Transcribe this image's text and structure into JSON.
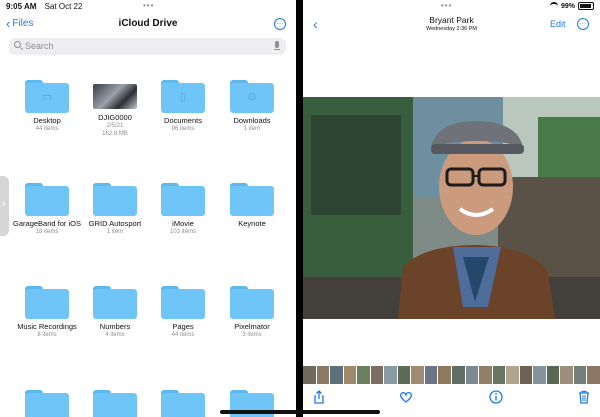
{
  "status": {
    "time": "9:05 AM",
    "date": "Sat Oct 22",
    "wifi_icon": "wifi-icon",
    "battery": "99%",
    "battery_icon": "battery-icon"
  },
  "files": {
    "back_label": "Files",
    "title": "iCloud Drive",
    "more_icon": "ellipsis-circle-icon",
    "search_placeholder": "Search",
    "items": [
      {
        "name": "Desktop",
        "meta": "44 items",
        "meta2": "",
        "kind": "folder",
        "glyph": "▭"
      },
      {
        "name": "DJIG0000",
        "meta": "2/5/21",
        "meta2": "162.8 MB",
        "kind": "image",
        "glyph": ""
      },
      {
        "name": "Documents",
        "meta": "86 items",
        "meta2": "",
        "kind": "folder",
        "glyph": "▯"
      },
      {
        "name": "Downloads",
        "meta": "1 item",
        "meta2": "",
        "kind": "folder",
        "glyph": "⊙"
      },
      {
        "name": "GarageBand for iOS",
        "meta": "18 items",
        "meta2": "",
        "kind": "folder",
        "glyph": ""
      },
      {
        "name": "GRID Autosport",
        "meta": "1 item",
        "meta2": "",
        "kind": "folder",
        "glyph": ""
      },
      {
        "name": "iMovie",
        "meta": "103 items",
        "meta2": "",
        "kind": "folder",
        "glyph": ""
      },
      {
        "name": "Keynote",
        "meta": "",
        "meta2": "",
        "kind": "folder",
        "glyph": ""
      },
      {
        "name": "Music Recordings",
        "meta": "8 items",
        "meta2": "",
        "kind": "folder",
        "glyph": ""
      },
      {
        "name": "Numbers",
        "meta": "4 items",
        "meta2": "",
        "kind": "folder",
        "glyph": ""
      },
      {
        "name": "Pages",
        "meta": "44 items",
        "meta2": "",
        "kind": "folder",
        "glyph": ""
      },
      {
        "name": "Pixelmator",
        "meta": "3 items",
        "meta2": "",
        "kind": "folder",
        "glyph": ""
      },
      {
        "name": "",
        "meta": "",
        "meta2": "",
        "kind": "folder",
        "glyph": ""
      },
      {
        "name": "",
        "meta": "",
        "meta2": "",
        "kind": "folder",
        "glyph": ""
      },
      {
        "name": "",
        "meta": "",
        "meta2": "",
        "kind": "folder",
        "glyph": ""
      },
      {
        "name": "",
        "meta": "",
        "meta2": "",
        "kind": "folder",
        "glyph": ""
      }
    ]
  },
  "photos": {
    "title": "Bryant Park",
    "subtitle": "Wednesday  2:36 PM",
    "edit_label": "Edit",
    "back_icon": "chevron-left-icon",
    "more_icon": "ellipsis-circle-icon",
    "toolbar_icons": [
      "share-icon",
      "heart-icon",
      "info-icon",
      "trash-icon"
    ]
  },
  "colors": {
    "accent": "#1a7ce8",
    "folder": "#70c5f8",
    "text_secondary": "#8e8e93"
  }
}
